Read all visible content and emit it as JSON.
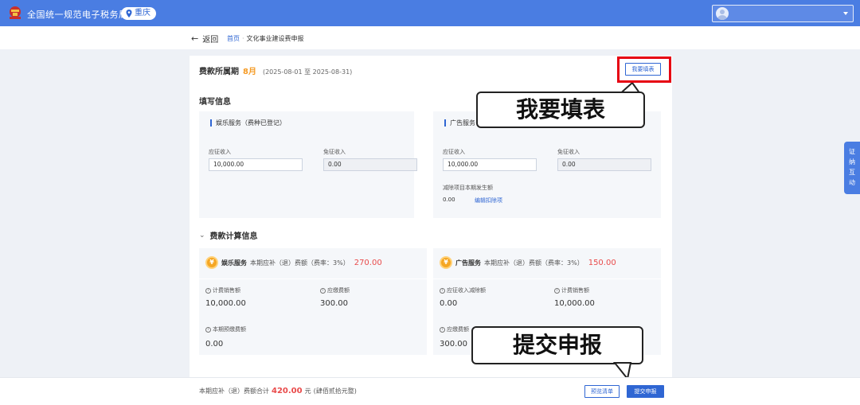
{
  "header": {
    "app_title": "全国统一规范电子税务局",
    "region": "重庆"
  },
  "breadcrumb": {
    "back_label": "返回",
    "home": "首页",
    "current": "文化事业建设费申报"
  },
  "period": {
    "label": "费款所属期",
    "month": "8月",
    "range": "(2025-08-01 至 2025-08-31)"
  },
  "fill_button_label": "我要填表",
  "fill_info": {
    "title": "填写信息",
    "entertainment": {
      "title": "娱乐服务（费种已登记）",
      "taxable_label": "应征收入",
      "taxable_value": "10,000.00",
      "exempt_label": "免征收入",
      "exempt_value": "0.00"
    },
    "advertising": {
      "title": "广告服务",
      "taxable_label": "应征收入",
      "taxable_value": "10,000.00",
      "exempt_label": "免征收入",
      "exempt_value": "0.00",
      "deduction_label": "减除项目本期发生额",
      "deduction_value": "0.00",
      "edit_link": "编辑扣除项"
    }
  },
  "calc_info": {
    "title": "费款计算信息",
    "entertainment": {
      "name": "娱乐服务",
      "desc": "本期应补（退）费额（费率：3%）",
      "amount": "270.00",
      "m1_label": "计费销售额",
      "m1_value": "10,000.00",
      "m2_label": "应缴费额",
      "m2_value": "300.00",
      "m3_label": "本期预缴费额",
      "m3_value": "0.00"
    },
    "advertising": {
      "name": "广告服务",
      "desc": "本期应补（退）费额（费率：3%）",
      "amount": "150.00",
      "m1_label": "应征收入减除额",
      "m1_value": "0.00",
      "m2_label": "计费销售额",
      "m2_value": "10,000.00",
      "m3_label": "应缴费额",
      "m3_value": "300.00"
    }
  },
  "callouts": {
    "fill": "我要填表",
    "submit": "提交申报"
  },
  "footer": {
    "total_prefix": "本期应补（退）费额合计",
    "total_amount": "420.00",
    "total_unit": "元",
    "total_words": "(肆佰贰拾元整)",
    "preview_label": "预览清单",
    "submit_label": "提交申报"
  },
  "side_tab": [
    "证",
    "纳",
    "互",
    "动"
  ],
  "colors": {
    "primary": "#2f66d3",
    "header": "#4a7de2",
    "highlight": "#e60012",
    "amount": "#e94b4b",
    "month": "#f59a23"
  }
}
